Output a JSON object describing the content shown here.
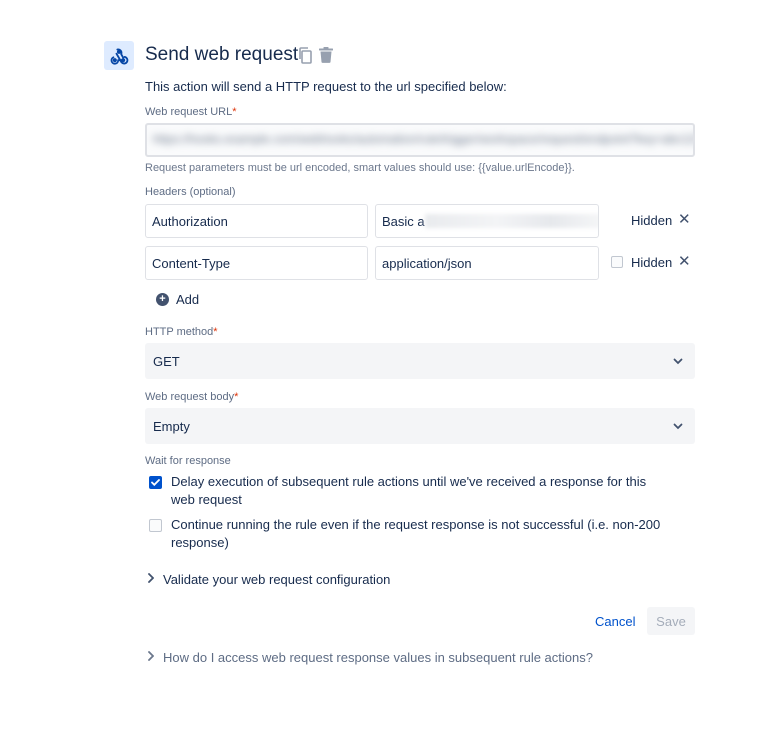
{
  "header": {
    "title": "Send web request",
    "icon": "webhook-icon",
    "actions": [
      "copy-icon",
      "trash-icon"
    ]
  },
  "description": "This action will send a HTTP request to the url specified below:",
  "url_field": {
    "label": "Web request URL",
    "required_mark": "*",
    "value": "https://hooks.example.com/webhooks/automation/rule/trigger/workspace/request/endpoint?key=abc123",
    "helper": "Request parameters must be url encoded, smart values should use: {{value.urlEncode}}."
  },
  "headers": {
    "label": "Headers (optional)",
    "rows": [
      {
        "key": "Authorization",
        "value": "Basic a",
        "hidden_label": "Hidden",
        "hidden_checked": false
      },
      {
        "key": "Content-Type",
        "value": "application/json",
        "hidden_label": "Hidden",
        "hidden_checked": false
      }
    ],
    "add_label": "Add"
  },
  "http_method": {
    "label": "HTTP method",
    "required_mark": "*",
    "value": "GET"
  },
  "request_body": {
    "label": "Web request body",
    "required_mark": "*",
    "value": "Empty"
  },
  "wait": {
    "label": "Wait for response",
    "options": [
      {
        "text": "Delay execution of subsequent rule actions until we've received a response for this web request",
        "checked": true
      },
      {
        "text": "Continue running the rule even if the request response is not successful (i.e. non-200 response)",
        "checked": false
      }
    ]
  },
  "validate_label": "Validate your web request configuration",
  "footer": {
    "cancel": "Cancel",
    "save": "Save"
  },
  "help_link": "How do I access web request response values in subsequent rule actions?",
  "colors": {
    "primary": "#0052cc",
    "text": "#172b4d",
    "subtle": "#5e6c84",
    "required": "#de350b"
  }
}
